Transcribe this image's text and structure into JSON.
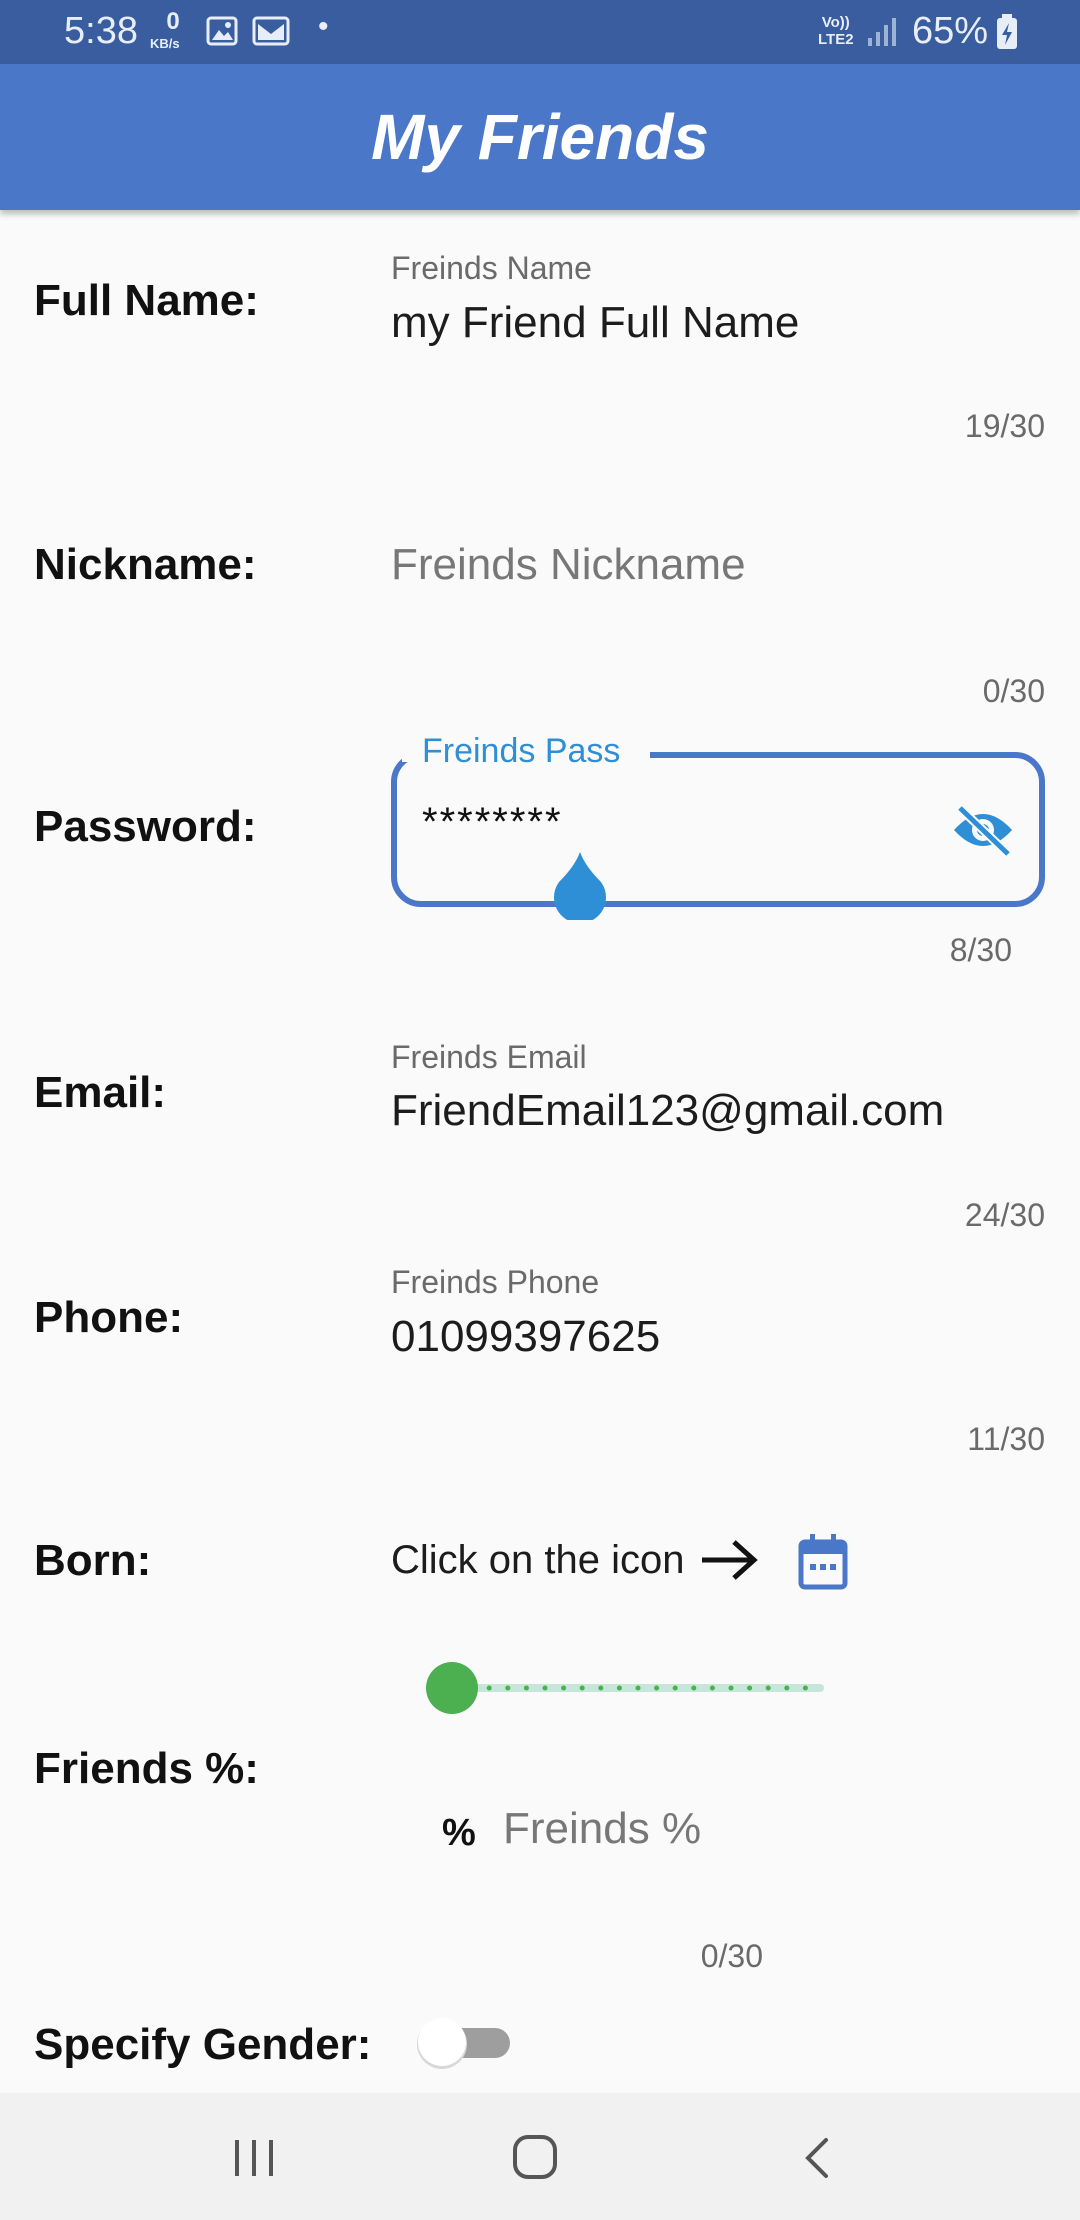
{
  "status_bar": {
    "time": "5:38",
    "kbs_value": "0",
    "kbs_unit": "KB/s",
    "dot": "•",
    "volte_line1": "Vo))",
    "volte_line2": "LTE2",
    "battery_percent": "65%"
  },
  "app_bar": {
    "title": "My Friends"
  },
  "form": {
    "full_name": {
      "label": "Full Name:",
      "hint": "Freinds Name",
      "value": "my Friend Full Name",
      "counter": "19/30"
    },
    "nickname": {
      "label": "Nickname:",
      "placeholder": "Freinds Nickname",
      "counter": "0/30"
    },
    "password": {
      "label": "Password:",
      "floating_label": "Freinds Pass",
      "value": "********",
      "counter": "8/30"
    },
    "email": {
      "label": "Email:",
      "hint": "Freinds Email",
      "value": "FriendEmail123@gmail.com",
      "counter": "24/30"
    },
    "phone": {
      "label": "Phone:",
      "hint": "Freinds Phone",
      "value": "01099397625",
      "counter": "11/30"
    },
    "born": {
      "label": "Born:",
      "instruction": "Click on the icon"
    },
    "friends_percent": {
      "label": "Friends %:",
      "prefix": "%",
      "placeholder": "Freinds %",
      "counter": "0/30",
      "slider_value": 0
    },
    "gender": {
      "label": "Specify Gender:",
      "switch_on": false
    }
  },
  "icons": {
    "eye": "visibility-off-icon",
    "arrow": "arrow-right-icon",
    "calendar": "calendar-icon",
    "slider_thumb_color": "#4caf50",
    "accent": "#4a77c8",
    "focus_color": "#2f8fd6"
  },
  "nav_bar": {
    "recents": "recents-icon",
    "home": "home-icon",
    "back": "back-icon"
  }
}
